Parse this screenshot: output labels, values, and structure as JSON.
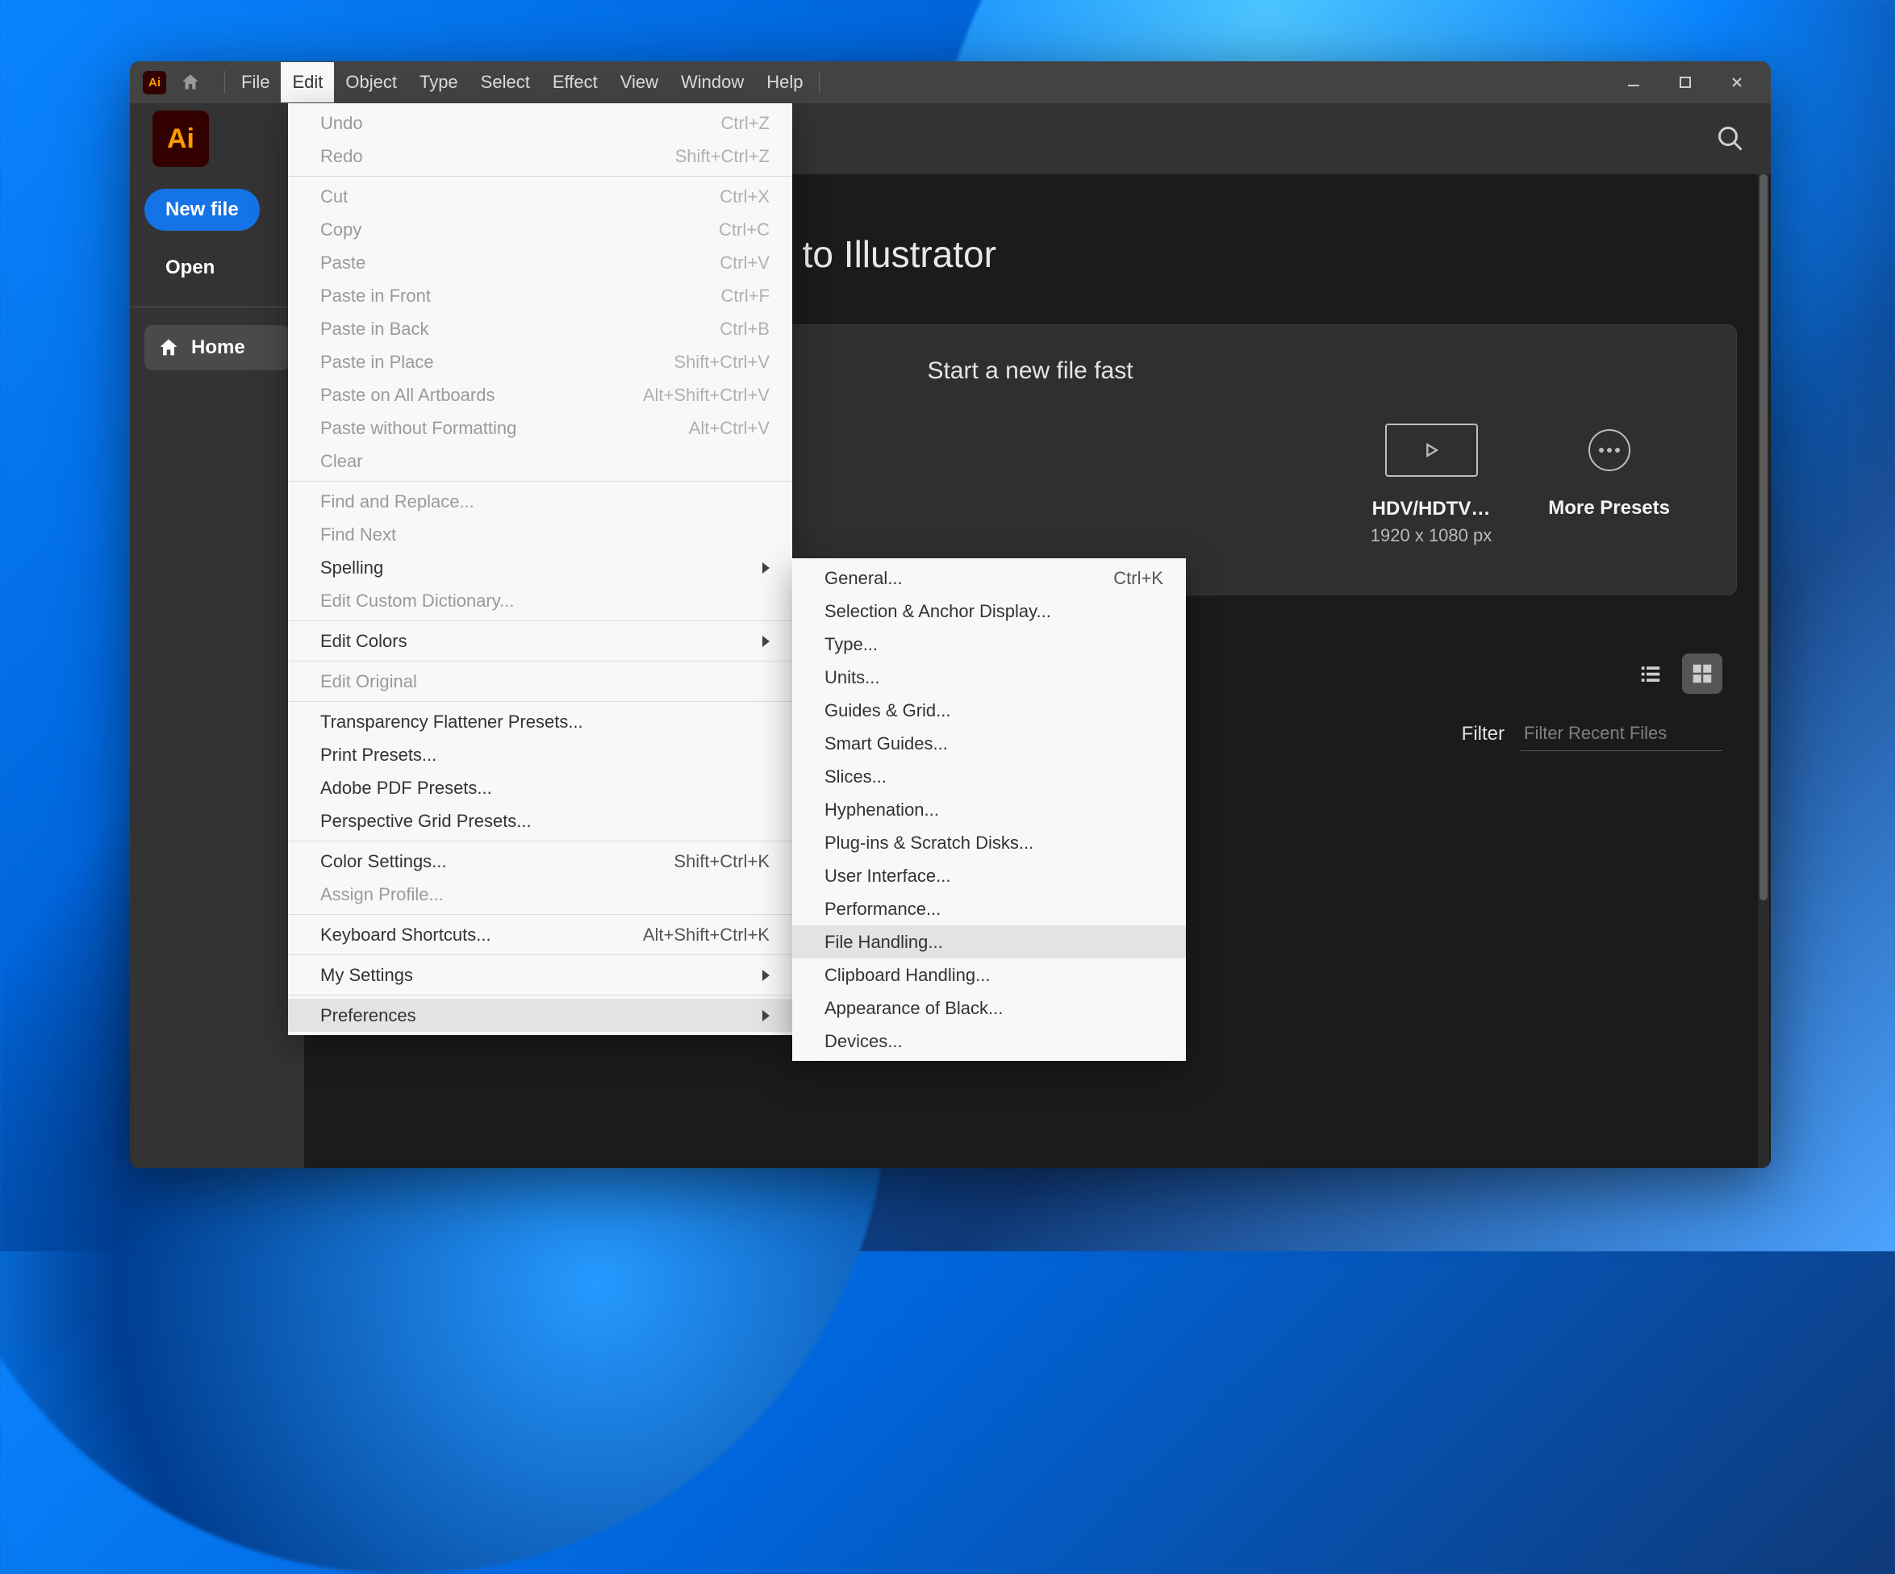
{
  "app": {
    "badge": "Ai",
    "brand": "Ai"
  },
  "menubar": [
    "File",
    "Edit",
    "Object",
    "Type",
    "Select",
    "Effect",
    "View",
    "Window",
    "Help"
  ],
  "sidebar": {
    "new_file": "New file",
    "open": "Open",
    "home": "Home"
  },
  "main": {
    "welcome": "Welcome to Illustrator",
    "start_fast": "Start a new file fast",
    "presets": [
      {
        "label": "HDV/HDTV…",
        "sub": "1920 x 1080 px"
      },
      {
        "label": "More Presets",
        "sub": ""
      }
    ],
    "filter_label": "Filter",
    "filter_placeholder": "Filter Recent Files"
  },
  "edit_menu": [
    {
      "t": "item",
      "label": "Undo",
      "shortcut": "Ctrl+Z",
      "disabled": true
    },
    {
      "t": "item",
      "label": "Redo",
      "shortcut": "Shift+Ctrl+Z",
      "disabled": true
    },
    {
      "t": "div"
    },
    {
      "t": "item",
      "label": "Cut",
      "shortcut": "Ctrl+X",
      "disabled": true
    },
    {
      "t": "item",
      "label": "Copy",
      "shortcut": "Ctrl+C",
      "disabled": true
    },
    {
      "t": "item",
      "label": "Paste",
      "shortcut": "Ctrl+V",
      "disabled": true
    },
    {
      "t": "item",
      "label": "Paste in Front",
      "shortcut": "Ctrl+F",
      "disabled": true
    },
    {
      "t": "item",
      "label": "Paste in Back",
      "shortcut": "Ctrl+B",
      "disabled": true
    },
    {
      "t": "item",
      "label": "Paste in Place",
      "shortcut": "Shift+Ctrl+V",
      "disabled": true
    },
    {
      "t": "item",
      "label": "Paste on All Artboards",
      "shortcut": "Alt+Shift+Ctrl+V",
      "disabled": true
    },
    {
      "t": "item",
      "label": "Paste without Formatting",
      "shortcut": "Alt+Ctrl+V",
      "disabled": true
    },
    {
      "t": "item",
      "label": "Clear",
      "shortcut": "",
      "disabled": true
    },
    {
      "t": "div"
    },
    {
      "t": "item",
      "label": "Find and Replace...",
      "shortcut": "",
      "disabled": true
    },
    {
      "t": "item",
      "label": "Find Next",
      "shortcut": "",
      "disabled": true
    },
    {
      "t": "item",
      "label": "Spelling",
      "shortcut": "",
      "sub": true
    },
    {
      "t": "item",
      "label": "Edit Custom Dictionary...",
      "shortcut": "",
      "disabled": true
    },
    {
      "t": "div"
    },
    {
      "t": "item",
      "label": "Edit Colors",
      "shortcut": "",
      "sub": true
    },
    {
      "t": "div"
    },
    {
      "t": "item",
      "label": "Edit Original",
      "shortcut": "",
      "disabled": true
    },
    {
      "t": "div"
    },
    {
      "t": "item",
      "label": "Transparency Flattener Presets...",
      "shortcut": ""
    },
    {
      "t": "item",
      "label": "Print Presets...",
      "shortcut": ""
    },
    {
      "t": "item",
      "label": "Adobe PDF Presets...",
      "shortcut": ""
    },
    {
      "t": "item",
      "label": "Perspective Grid Presets...",
      "shortcut": ""
    },
    {
      "t": "div"
    },
    {
      "t": "item",
      "label": "Color Settings...",
      "shortcut": "Shift+Ctrl+K"
    },
    {
      "t": "item",
      "label": "Assign Profile...",
      "shortcut": "",
      "disabled": true
    },
    {
      "t": "div"
    },
    {
      "t": "item",
      "label": "Keyboard Shortcuts...",
      "shortcut": "Alt+Shift+Ctrl+K"
    },
    {
      "t": "div"
    },
    {
      "t": "item",
      "label": "My Settings",
      "shortcut": "",
      "sub": true
    },
    {
      "t": "div"
    },
    {
      "t": "item",
      "label": "Preferences",
      "shortcut": "",
      "sub": true,
      "highlight": true
    }
  ],
  "pref_submenu": [
    {
      "label": "General...",
      "shortcut": "Ctrl+K"
    },
    {
      "label": "Selection & Anchor Display..."
    },
    {
      "label": "Type..."
    },
    {
      "label": "Units..."
    },
    {
      "label": "Guides & Grid..."
    },
    {
      "label": "Smart Guides..."
    },
    {
      "label": "Slices..."
    },
    {
      "label": "Hyphenation..."
    },
    {
      "label": "Plug-ins & Scratch Disks..."
    },
    {
      "label": "User Interface..."
    },
    {
      "label": "Performance..."
    },
    {
      "label": "File Handling...",
      "highlight": true
    },
    {
      "label": "Clipboard Handling..."
    },
    {
      "label": "Appearance of Black..."
    },
    {
      "label": "Devices..."
    }
  ]
}
